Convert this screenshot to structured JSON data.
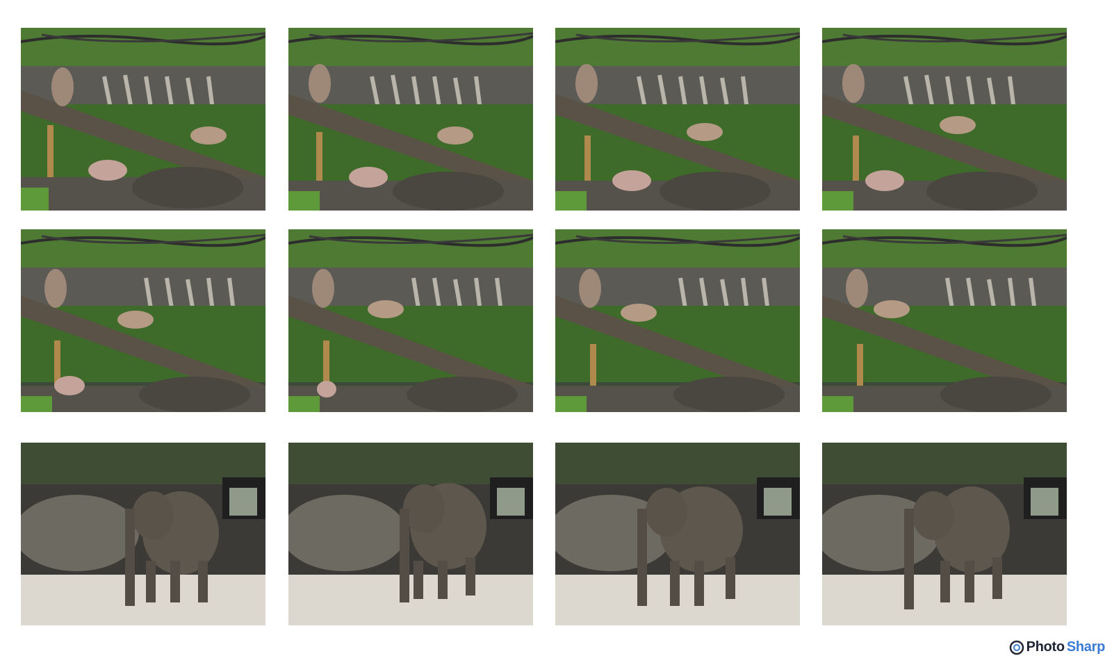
{
  "collage": {
    "rows": [
      {
        "subject": "monkeys-on-log",
        "count": 4
      },
      {
        "subject": "monkeys-on-log",
        "count": 4
      },
      {
        "subject": "elephant",
        "count": 4
      }
    ]
  },
  "watermark": {
    "brand_part1": "Photo",
    "brand_part2": "Sharp",
    "color_part1": "#1d2433",
    "color_part2": "#3a7bd5"
  },
  "colors": {
    "background": "#ffffff",
    "foliage": "#5f9a3a",
    "water": "#3f6b2a",
    "rock": "#6d6a62",
    "log": "#5a5246",
    "monkey": "#b59a86",
    "sand": "#dcd8cf",
    "elephant": "#5e574e"
  }
}
